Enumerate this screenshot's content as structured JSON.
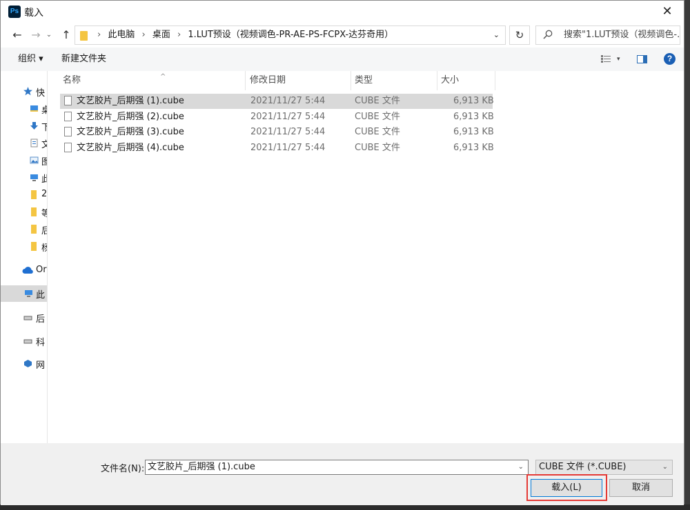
{
  "window": {
    "title": "载入",
    "app_badge": "Ps"
  },
  "nav": {
    "back_glyph": "←",
    "forward_glyph": "→",
    "up_glyph": "↑",
    "breadcrumbs": [
      "此电脑",
      "桌面",
      "1.LUT预设（视频调色-PR-AE-PS-FCPX-达芬奇用）"
    ],
    "search_placeholder": "搜索\"1.LUT预设（视频调色-..."
  },
  "toolbar": {
    "organize": "组织 ▾",
    "new_folder": "新建文件夹",
    "help": "?"
  },
  "sidebar": {
    "items": [
      {
        "label": "快",
        "icon": "star-icon",
        "selected": false
      },
      {
        "label": "桌",
        "icon": "folder-icon",
        "selected": false
      },
      {
        "label": "下",
        "icon": "download-icon",
        "selected": false
      },
      {
        "label": "文",
        "icon": "document-icon",
        "selected": false
      },
      {
        "label": "图",
        "icon": "picture-icon",
        "selected": false
      },
      {
        "label": "此",
        "icon": "computer-icon",
        "selected": false
      },
      {
        "label": "2",
        "icon": "folder-icon",
        "selected": false
      },
      {
        "label": "等",
        "icon": "folder-icon",
        "selected": false
      },
      {
        "label": "后",
        "icon": "folder-icon",
        "selected": false
      },
      {
        "label": "杨",
        "icon": "folder-icon",
        "selected": false
      },
      {
        "label": "Or",
        "icon": "cloud-icon",
        "selected": false
      },
      {
        "label": "此",
        "icon": "computer-icon",
        "selected": true
      },
      {
        "label": "后",
        "icon": "drive-icon",
        "selected": false
      },
      {
        "label": "科",
        "icon": "drive-icon",
        "selected": false
      },
      {
        "label": "网",
        "icon": "network-icon",
        "selected": false
      }
    ]
  },
  "columns": {
    "name": "名称",
    "date": "修改日期",
    "type": "类型",
    "size": "大小"
  },
  "files": [
    {
      "name": "文艺胶片_后期强 (1).cube",
      "date": "2021/11/27 5:44",
      "type": "CUBE 文件",
      "size": "6,913 KB",
      "selected": true
    },
    {
      "name": "文艺胶片_后期强 (2).cube",
      "date": "2021/11/27 5:44",
      "type": "CUBE 文件",
      "size": "6,913 KB",
      "selected": false
    },
    {
      "name": "文艺胶片_后期强 (3).cube",
      "date": "2021/11/27 5:44",
      "type": "CUBE 文件",
      "size": "6,913 KB",
      "selected": false
    },
    {
      "name": "文艺胶片_后期强 (4).cube",
      "date": "2021/11/27 5:44",
      "type": "CUBE 文件",
      "size": "6,913 KB",
      "selected": false
    }
  ],
  "footer": {
    "filename_label": "文件名(N):",
    "filename_value": "文艺胶片_后期强 (1).cube",
    "filetype_value": "CUBE 文件 (*.CUBE)",
    "open_button": "载入(L)",
    "cancel_button": "取消"
  },
  "colors": {
    "accent": "#0078d7",
    "highlight": "#e53935",
    "folder": "#f4c542"
  }
}
